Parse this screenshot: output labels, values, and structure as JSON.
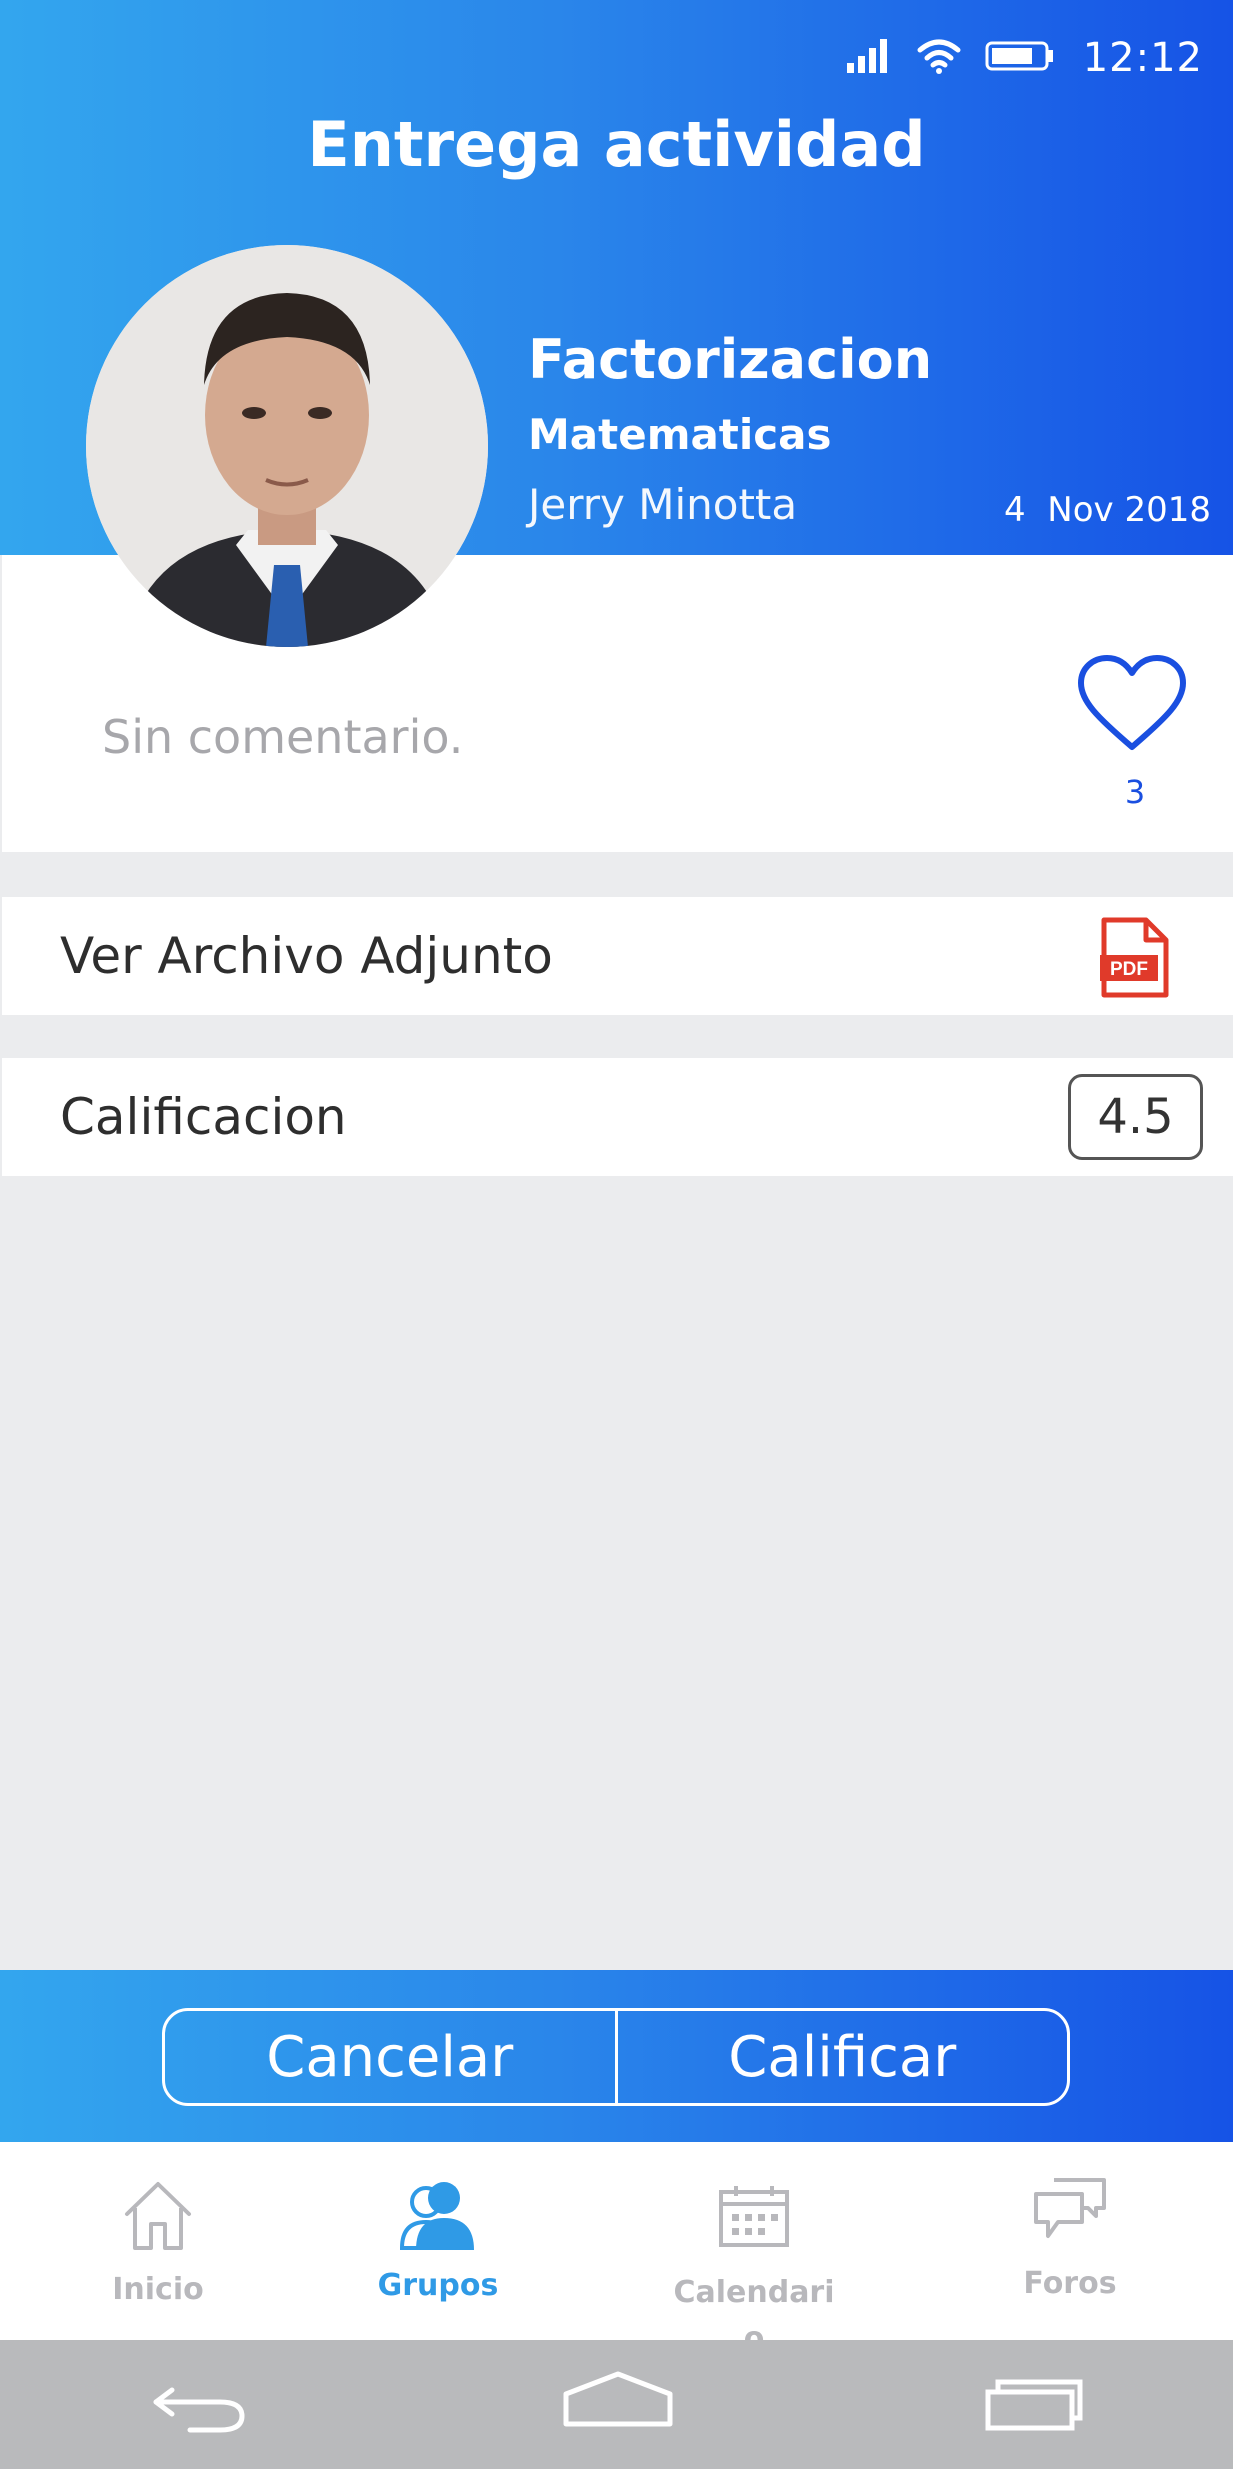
{
  "status_bar": {
    "time": "12:12",
    "icons": [
      "signal-icon",
      "wifi-icon",
      "battery-icon"
    ]
  },
  "header": {
    "title": "Entrega actividad",
    "activity": "Factorizacion",
    "subject": "Matematicas",
    "student": "Jerry Minotta",
    "date": "4  Nov 2018"
  },
  "comment": {
    "text": "Sin comentario.",
    "likes": "3"
  },
  "attachment": {
    "label": "Ver Archivo Adjunto",
    "icon": "pdf-icon",
    "icon_text": "PDF"
  },
  "grade": {
    "label": "Calificacion",
    "value": "4.5"
  },
  "actions": {
    "cancel": "Cancelar",
    "grade": "Calificar"
  },
  "nav": {
    "items": [
      {
        "label": "Inicio",
        "icon": "home-icon",
        "active": false
      },
      {
        "label": "Grupos",
        "icon": "users-icon",
        "active": true
      },
      {
        "label": "Calendari\no",
        "icon": "calendar-icon",
        "active": false
      },
      {
        "label": "Foros",
        "icon": "chat-icon",
        "active": false
      }
    ]
  },
  "colors": {
    "accent": "#2f9ae6",
    "gradient_start": "#33a6ee",
    "gradient_end": "#1653e6",
    "like": "#1a4fe0",
    "pdf": "#e03a2a"
  }
}
